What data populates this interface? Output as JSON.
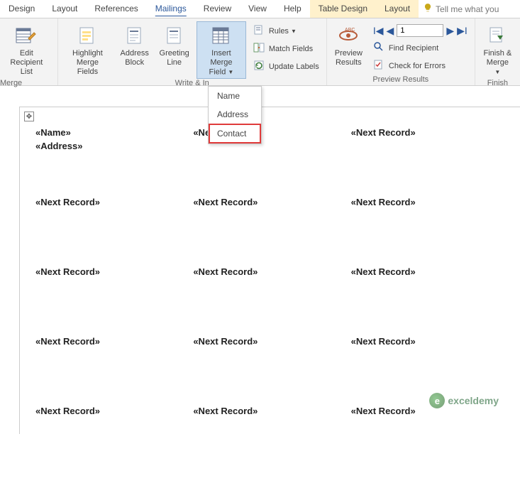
{
  "tabs": {
    "design": "Design",
    "layout1": "Layout",
    "references": "References",
    "mailings": "Mailings",
    "review": "Review",
    "view": "View",
    "help": "Help",
    "tableDesign": "Table Design",
    "layout2": "Layout",
    "tellMe": "Tell me what you"
  },
  "ribbon": {
    "editRecipient": "Edit\nRecipient List",
    "highlightMerge": "Highlight\nMerge Fields",
    "addressBlock": "Address\nBlock",
    "greetingLine": "Greeting\nLine",
    "insertMerge": "Insert Merge\nField",
    "rules": "Rules",
    "matchFields": "Match Fields",
    "updateLabels": "Update Labels",
    "previewResults": "Preview\nResults",
    "findRecipient": "Find Recipient",
    "checkErrors": "Check for Errors",
    "finishMerge": "Finish &\nMerge",
    "navValue": "1",
    "groupMerge": "Merge",
    "groupWrite": "Write & In",
    "groupPreview": "Preview Results",
    "groupFinish": "Finish"
  },
  "dropdown": {
    "name": "Name",
    "address": "Address",
    "contact": "Contact"
  },
  "doc": {
    "nameField": "«Name»",
    "addressField": "«Address»",
    "nextRecord": "«Next Record»"
  },
  "watermark": "exceldemy"
}
